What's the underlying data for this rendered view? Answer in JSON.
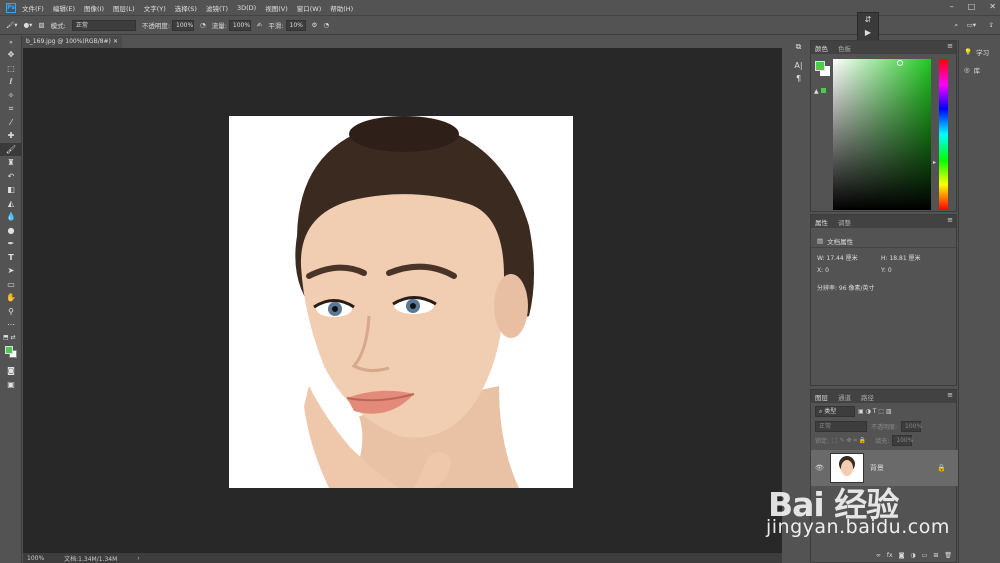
{
  "menubar": {
    "logo": "Ps",
    "items": [
      "文件(F)",
      "编辑(E)",
      "图像(I)",
      "图层(L)",
      "文字(Y)",
      "选择(S)",
      "滤镜(T)",
      "3D(D)",
      "视图(V)",
      "窗口(W)",
      "帮助(H)"
    ]
  },
  "options": {
    "mode_label": "模式:",
    "mode_value": "正常",
    "opacity_label": "不透明度:",
    "opacity_value": "100%",
    "flow_label": "流量:",
    "flow_value": "100%",
    "smooth_label": "平滑:",
    "smooth_value": "10%"
  },
  "document": {
    "tab_title": "b_169.jpg @ 100%(RGB/8#)",
    "zoom": "100%",
    "doc_size": "文档:1.34M/1.34M"
  },
  "color_panel": {
    "tabs": [
      "颜色",
      "色板"
    ],
    "fg_color": "#4ccc4c",
    "bg_color": "#ffffff"
  },
  "props_panel": {
    "tabs": [
      "属性",
      "调整"
    ],
    "section": "文档属性",
    "w_label": "W:",
    "w_value": "17.44 厘米",
    "h_label": "H:",
    "h_value": "18.81 厘米",
    "x_label": "X:",
    "x_value": "0",
    "y_label": "Y:",
    "y_value": "0",
    "resolution": "分辨率: 96 像素/英寸"
  },
  "layers_panel": {
    "tabs": [
      "图层",
      "通道",
      "路径"
    ],
    "filter": "类型",
    "blend": "正常",
    "opacity_label": "不透明度:",
    "opacity_value": "100%",
    "lock_label": "锁定:",
    "fill_label": "填充:",
    "fill_value": "100%",
    "layer_name": "背景"
  },
  "right_column": {
    "learn": "学习",
    "library": "库"
  },
  "watermark": {
    "brand": "Bai 经验",
    "url": "jingyan.baidu.com"
  }
}
